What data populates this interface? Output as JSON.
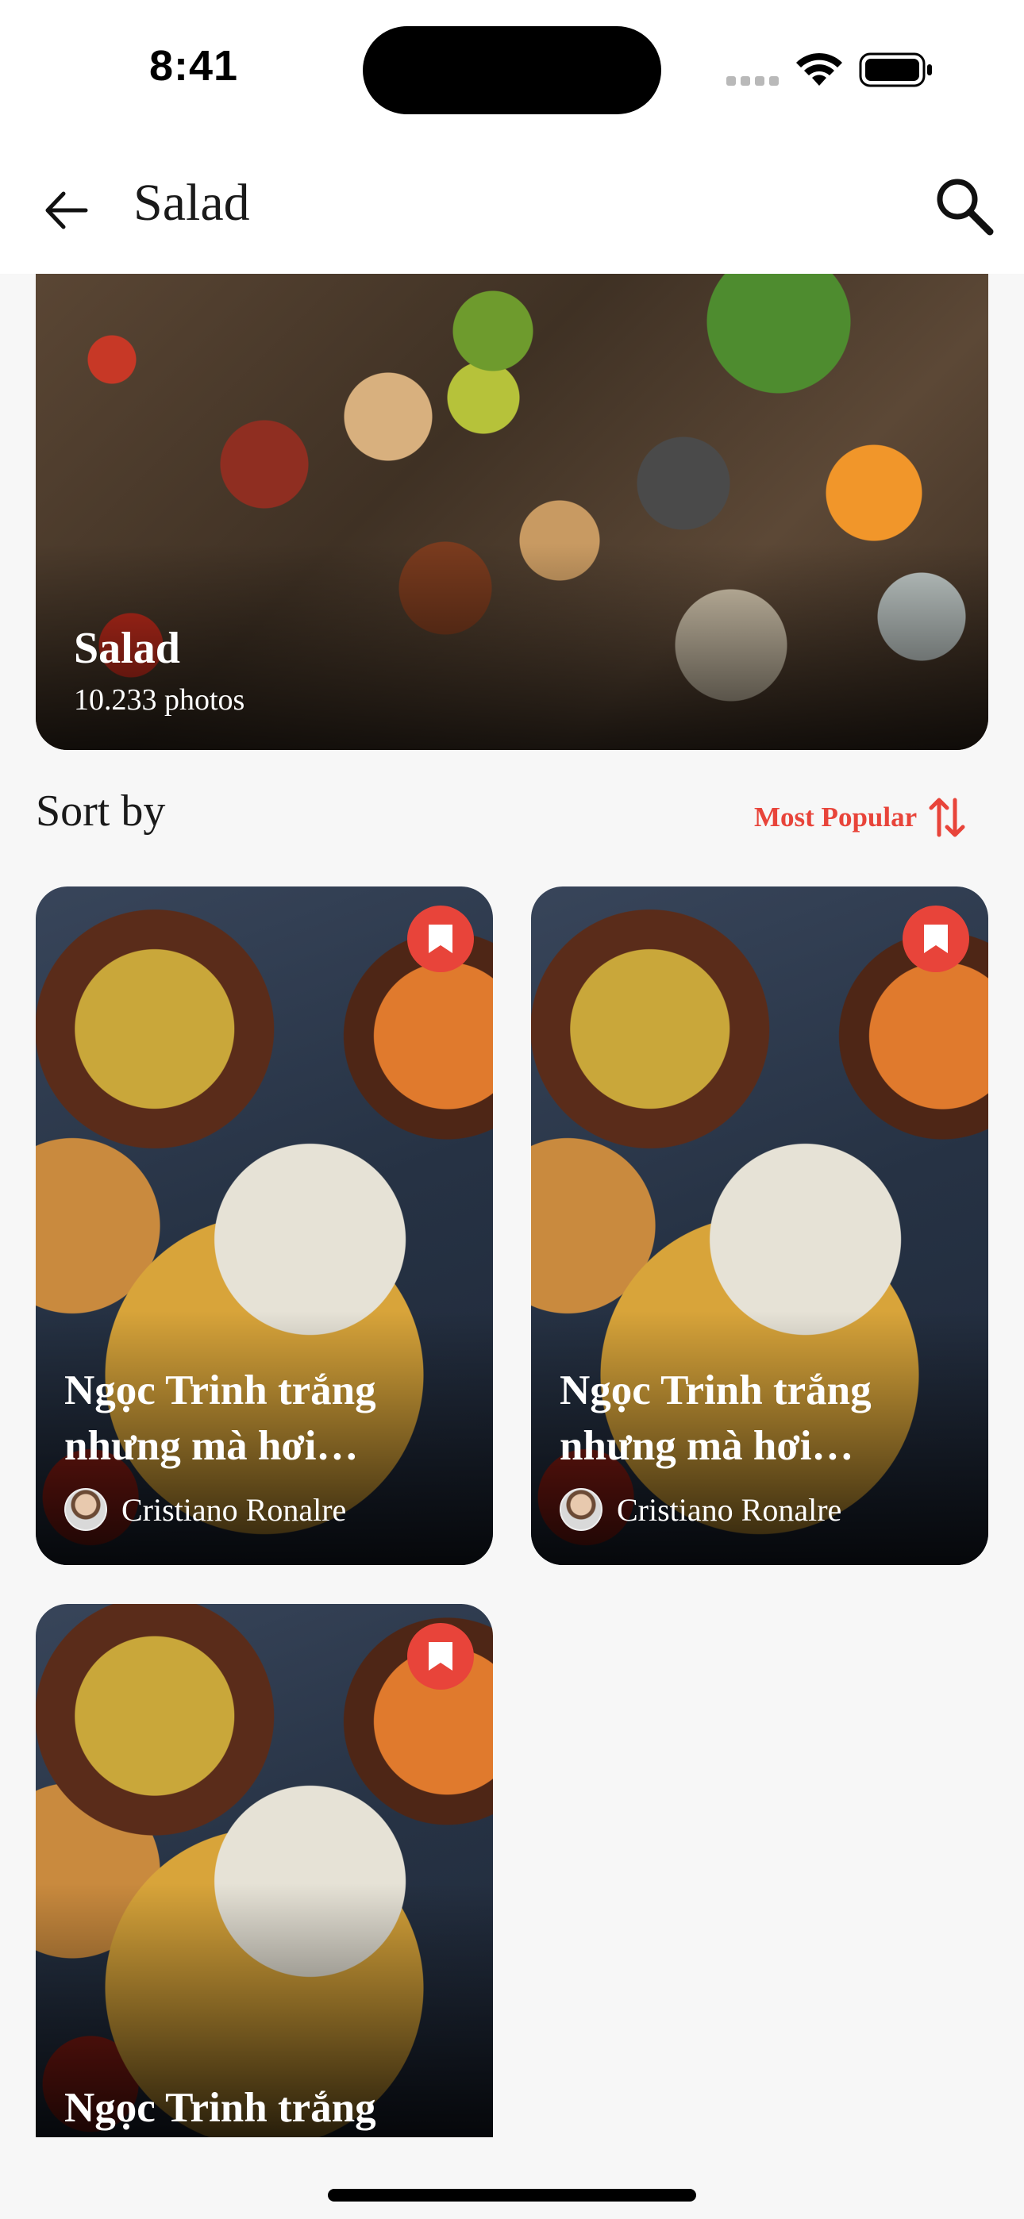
{
  "status_bar": {
    "time": "8:41"
  },
  "header": {
    "title": "Salad"
  },
  "hero": {
    "title": "Salad",
    "count": "10.233 photos"
  },
  "sort": {
    "label": "Sort by",
    "value": "Most Popular"
  },
  "recipes": [
    {
      "title": "Ngọc Trinh trắng nhưng mà hơi…",
      "author": "Cristiano Ronalre"
    },
    {
      "title": "Ngọc Trinh trắng nhưng mà hơi…",
      "author": "Cristiano Ronalre"
    },
    {
      "title": "Ngọc Trinh trắng"
    }
  ],
  "colors": {
    "accent": "#e8443a",
    "background": "#f7f7f7"
  },
  "icons": [
    "back-arrow-icon",
    "search-icon",
    "sort-arrows-icon",
    "bookmark-icon",
    "wifi-icon",
    "battery-icon",
    "signal-icon"
  ]
}
